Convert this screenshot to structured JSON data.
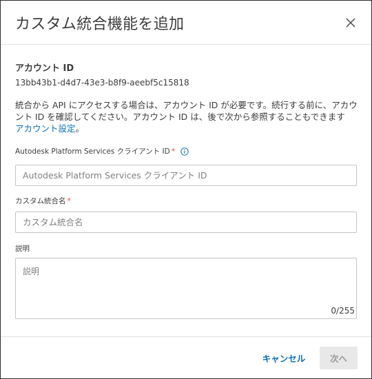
{
  "dialog": {
    "title": "カスタム統合機能を追加",
    "close_icon": "close-icon"
  },
  "account": {
    "label": "アカウント ID",
    "id_value": "13bb43b1-d4d7-43e3-b8f9-aeebf5c15818",
    "description": "統合から API にアクセスする場合は、アカウント ID が必要です。続行する前に、アカウント ID を確認してください。アカウント ID は、後で次から参照することもできます",
    "link_text": "アカウント設定",
    "link_suffix": "。"
  },
  "fields": {
    "client_id": {
      "label": "Autodesk Platform Services クライアント ID",
      "required_mark": "*",
      "placeholder": "Autodesk Platform Services クライアント ID",
      "value": "",
      "info_icon": "info-icon"
    },
    "name": {
      "label": "カスタム統合名",
      "required_mark": "*",
      "placeholder": "カスタム統合名",
      "value": ""
    },
    "description": {
      "label": "説明",
      "placeholder": "説明",
      "value": "",
      "counter": "0/255"
    }
  },
  "footer": {
    "cancel_label": "キャンセル",
    "next_label": "次へ"
  },
  "colors": {
    "accent": "#0e6fb8",
    "required": "#e3453a",
    "disabled_bg": "#e8e8e8",
    "disabled_text": "#9a9a9a"
  }
}
